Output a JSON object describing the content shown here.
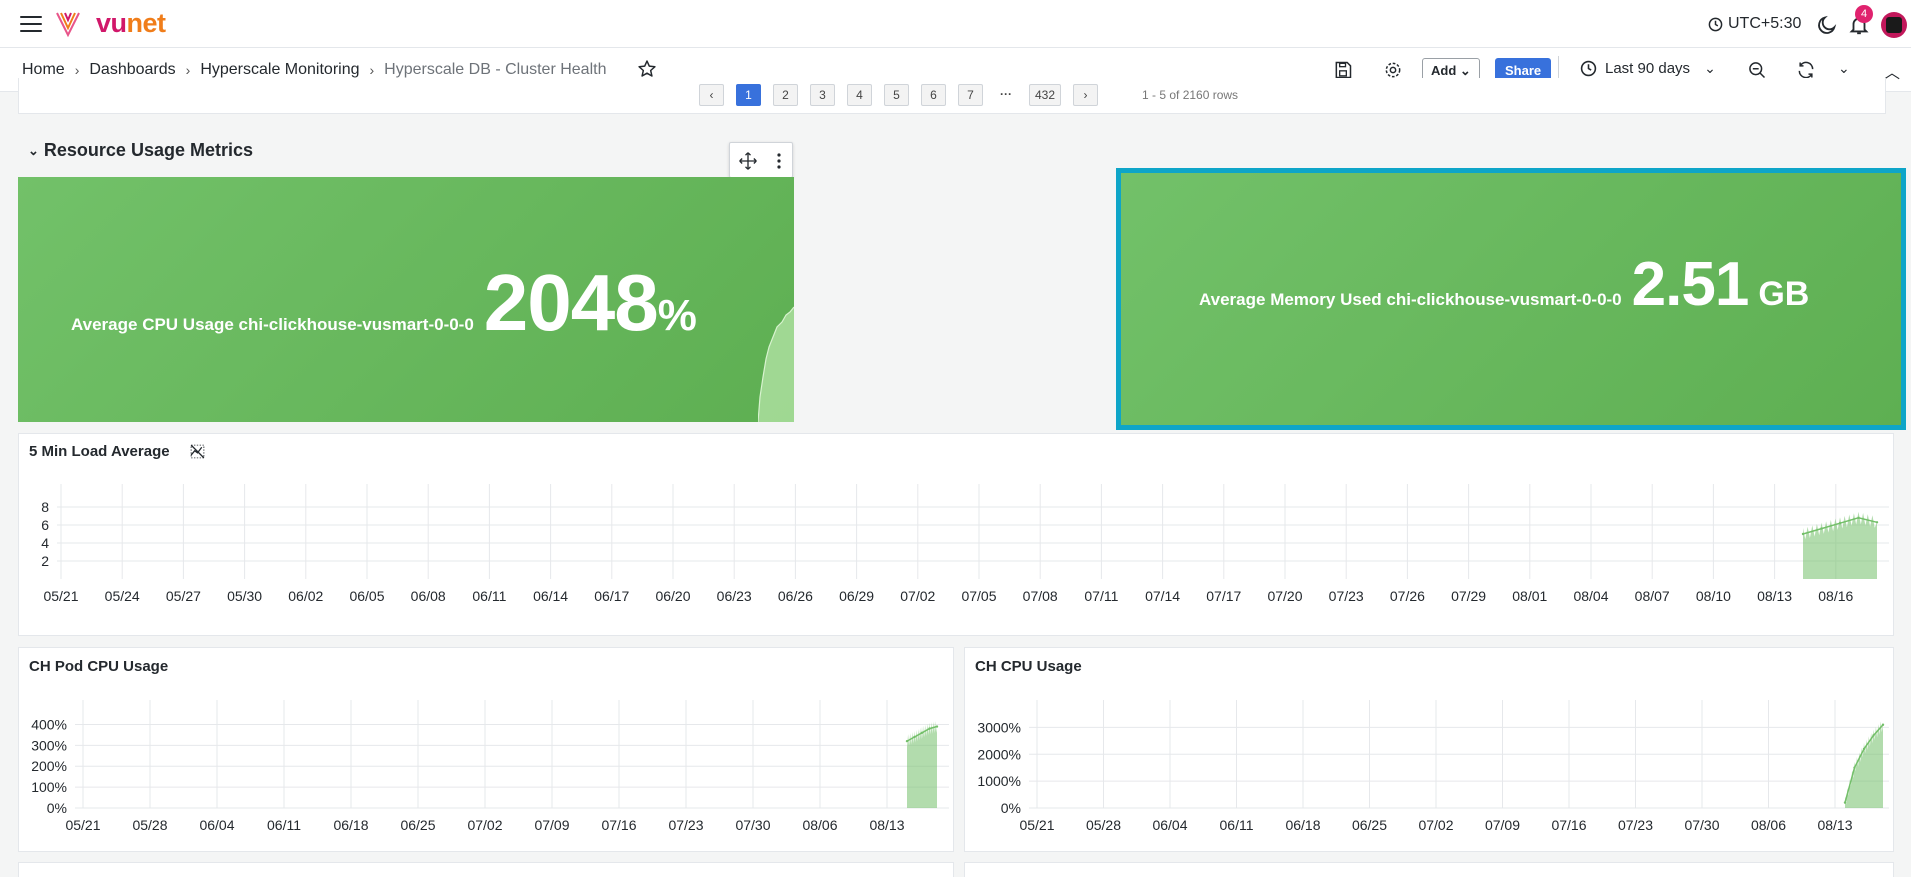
{
  "brand": {
    "vu": "vu",
    "net": "net"
  },
  "header": {
    "timezone": "UTC+5:30",
    "notifications": "4"
  },
  "breadcrumb": [
    "Home",
    "Dashboards",
    "Hyperscale Monitoring",
    "Hyperscale DB - Cluster Health"
  ],
  "toolbar": {
    "add_label": "Add",
    "share_label": "Share",
    "time_range": "Last 90 days"
  },
  "pagination": {
    "prev": "‹",
    "pages": [
      "1",
      "2",
      "3",
      "4",
      "5",
      "6",
      "7"
    ],
    "ellipsis": "···",
    "last": "432",
    "next": "›",
    "rows_info": "1 - 5 of 2160 rows"
  },
  "section": {
    "title": "Resource Usage Metrics"
  },
  "stats": [
    {
      "title": "Average CPU Usage chi-clickhouse-vusmart-0-0-0",
      "value": "2048",
      "unit": "%"
    },
    {
      "title": "Average Memory Used chi-clickhouse-vusmart-0-0-0",
      "value": "2.51",
      "unit": "GB"
    }
  ],
  "colors": {
    "stat_green": "#6ab85f",
    "series_green": "#73bf69",
    "accent_blue": "#3871dc",
    "selection_border": "#0ea5c8"
  },
  "chart_data": [
    {
      "type": "area",
      "title": "5 Min Load Average",
      "x_ticks": [
        "05/21",
        "05/24",
        "05/27",
        "05/30",
        "06/02",
        "06/05",
        "06/08",
        "06/11",
        "06/14",
        "06/17",
        "06/20",
        "06/23",
        "06/26",
        "06/29",
        "07/02",
        "07/05",
        "07/08",
        "07/11",
        "07/14",
        "07/17",
        "07/20",
        "07/23",
        "07/26",
        "07/29",
        "08/01",
        "08/04",
        "08/07",
        "08/10",
        "08/13",
        "08/16"
      ],
      "y_ticks": [
        "2",
        "4",
        "6",
        "8"
      ],
      "ylim": [
        0,
        9
      ],
      "x": [
        "08/14",
        "08/15",
        "08/16",
        "08/17",
        "08/18"
      ],
      "values": [
        5.0,
        5.6,
        6.2,
        6.8,
        6.3
      ],
      "grid": true
    },
    {
      "type": "area",
      "title": "CH Pod CPU Usage",
      "x_ticks": [
        "05/21",
        "05/28",
        "06/04",
        "06/11",
        "06/18",
        "06/25",
        "07/02",
        "07/09",
        "07/16",
        "07/23",
        "07/30",
        "08/06",
        "08/13"
      ],
      "y_ticks": [
        "0%",
        "100%",
        "200%",
        "300%",
        "400%"
      ],
      "ylim": [
        0,
        450
      ],
      "x": [
        "08/15",
        "08/16",
        "08/17",
        "08/18",
        "08/19"
      ],
      "values": [
        320,
        340,
        360,
        380,
        390
      ],
      "grid": true
    },
    {
      "type": "area",
      "title": "CH CPU Usage",
      "x_ticks": [
        "05/21",
        "05/28",
        "06/04",
        "06/11",
        "06/18",
        "06/25",
        "07/02",
        "07/09",
        "07/16",
        "07/23",
        "07/30",
        "08/06",
        "08/13"
      ],
      "y_ticks": [
        "0%",
        "1000%",
        "2000%",
        "3000%"
      ],
      "ylim": [
        0,
        3500
      ],
      "x": [
        "08/15",
        "08/16",
        "08/17",
        "08/18",
        "08/19"
      ],
      "values": [
        200,
        1500,
        2200,
        2700,
        3100
      ],
      "grid": true
    }
  ]
}
